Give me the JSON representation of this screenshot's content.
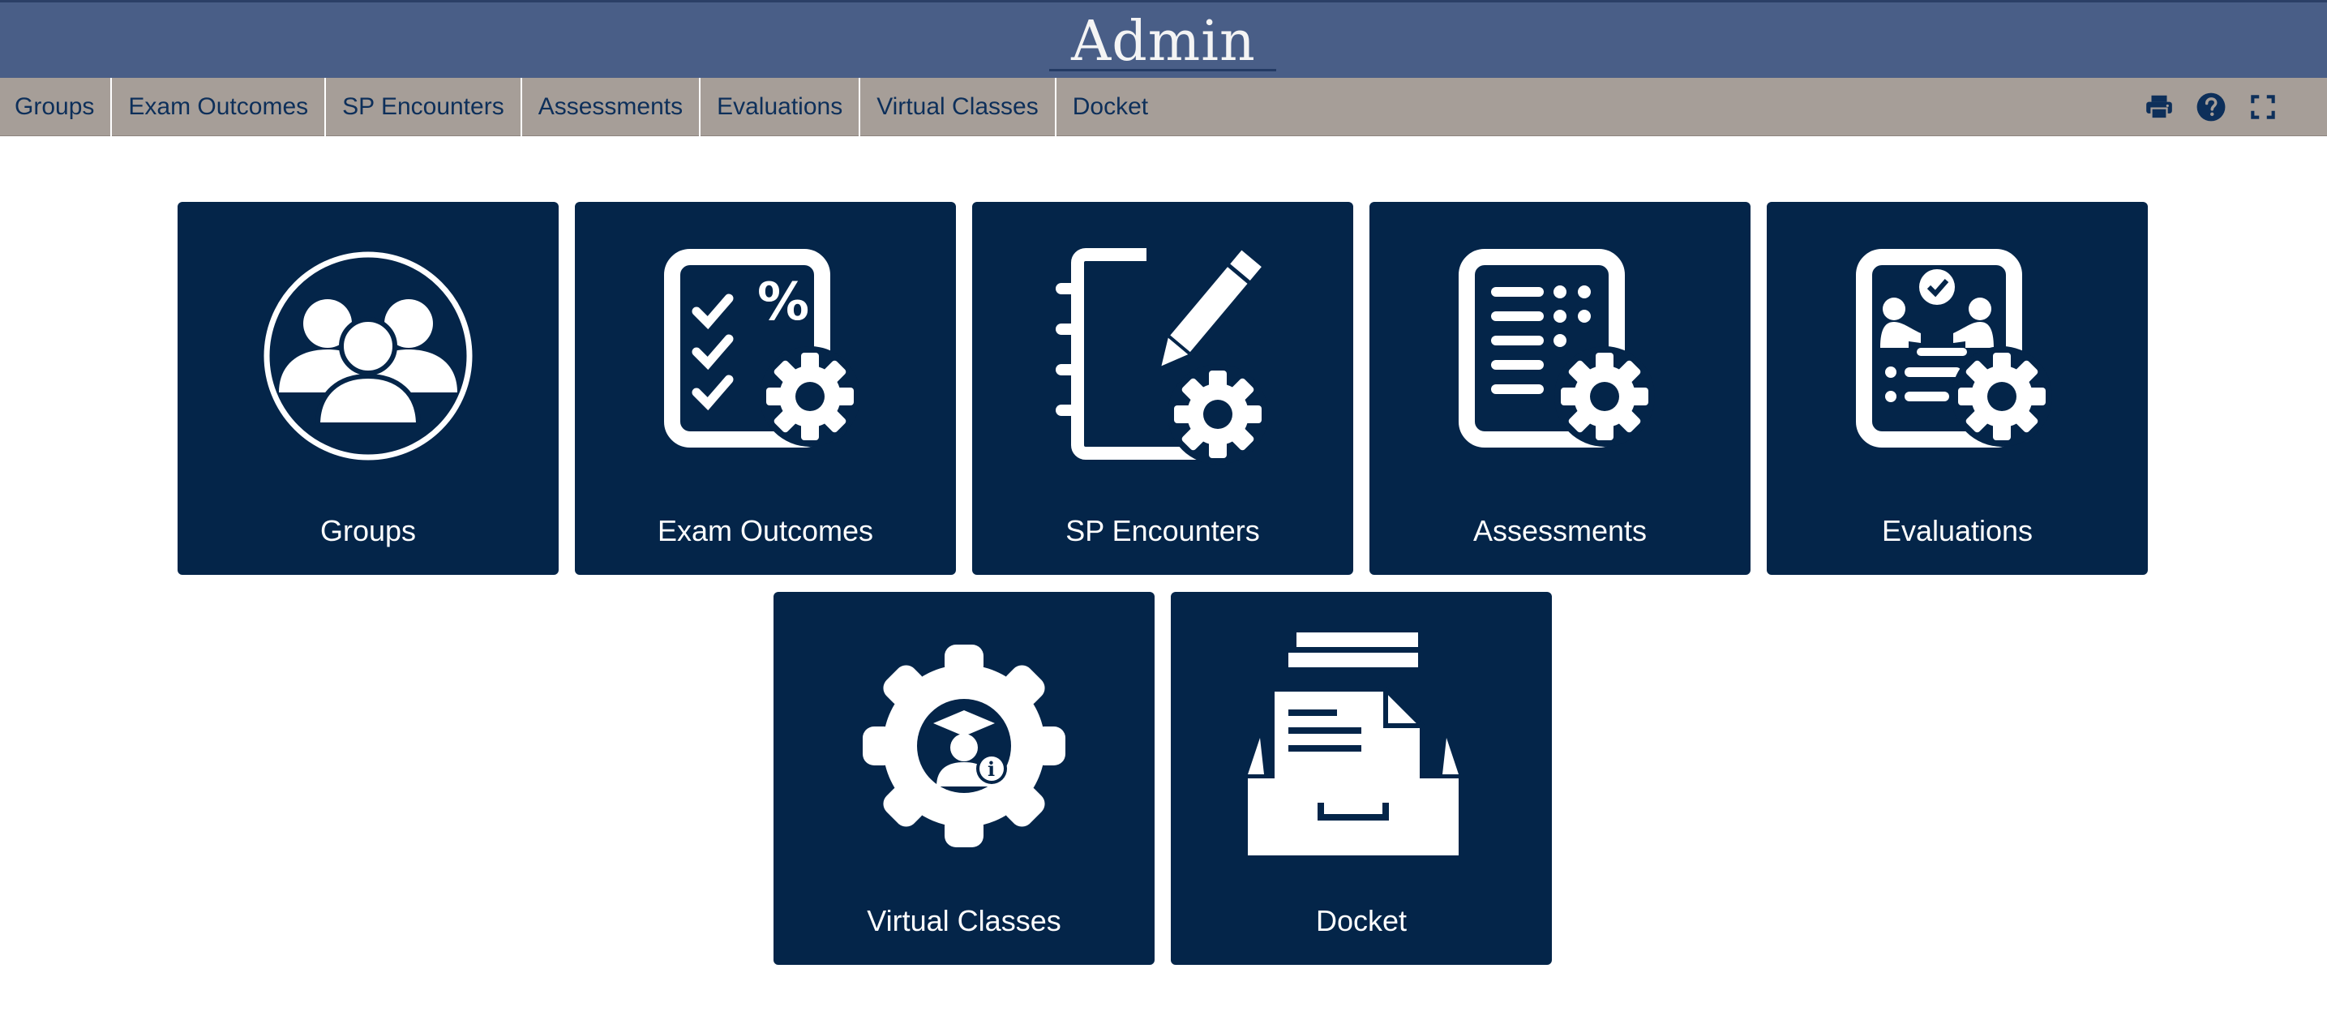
{
  "header": {
    "title": "Admin"
  },
  "nav": {
    "items": [
      {
        "label": "Groups"
      },
      {
        "label": "Exam Outcomes"
      },
      {
        "label": "SP Encounters"
      },
      {
        "label": "Assessments"
      },
      {
        "label": "Evaluations"
      },
      {
        "label": "Virtual Classes"
      },
      {
        "label": "Docket"
      }
    ]
  },
  "tools": {
    "print_icon": "print-icon",
    "help_icon": "help-icon",
    "fullscreen_icon": "fullscreen-icon"
  },
  "tiles": [
    {
      "label": "Groups",
      "icon": "groups-icon"
    },
    {
      "label": "Exam Outcomes",
      "icon": "exam-outcomes-icon"
    },
    {
      "label": "SP Encounters",
      "icon": "sp-encounters-icon"
    },
    {
      "label": "Assessments",
      "icon": "assessments-icon"
    },
    {
      "label": "Evaluations",
      "icon": "evaluations-icon"
    },
    {
      "label": "Virtual Classes",
      "icon": "virtual-classes-icon"
    },
    {
      "label": "Docket",
      "icon": "docket-icon"
    }
  ],
  "colors": {
    "header_bg": "#495e87",
    "toolbar_bg": "#a69e98",
    "tile_bg": "#042549",
    "nav_text": "#0d2f5a"
  }
}
